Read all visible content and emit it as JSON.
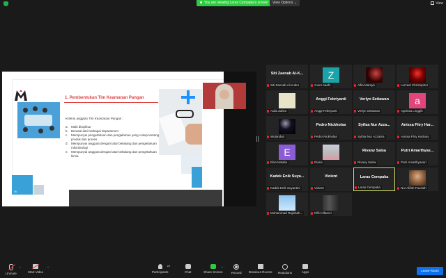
{
  "topbar": {
    "share_banner": "You are viewing Laras Cempaka's screen",
    "view_options": "View Options ⌄",
    "view_label": "View"
  },
  "slide": {
    "title": "1. Pembentukan Tim Keamanan Pangan",
    "criteria_heading": "Kriteria anggota Tim Keamanan Pangan :",
    "criteria": [
      {
        "letter": "a.",
        "text": "Multi disiplinar"
      },
      {
        "letter": "b.",
        "text": "Berasal dari berbagai departemen"
      },
      {
        "letter": "c.",
        "text": "Mempunyai pengetahuan dan pengalaman yang cukup tentang produk dan proses"
      },
      {
        "letter": "d.",
        "text": "Mempunyai anggota dengan latar belakang dan pengetahuan mikrobiologi"
      },
      {
        "letter": "e.",
        "text": "Mempunyai anggota dengan latar belakang dan pengetahuan kimia"
      }
    ],
    "page_number": "06"
  },
  "gallery": [
    {
      "big": "Siti Zaenab Al-K...",
      "label": "Siti Zaenab Al-Kubro"
    },
    {
      "letter": "Z",
      "color": "#1aa3a8",
      "label": "zoom baaf4"
    },
    {
      "avatar": "pink-light",
      "label": "Alfia Marsya"
    },
    {
      "avatar": "red-figure",
      "label": "Lurzael Christopher"
    },
    {
      "avatar": "cream",
      "label": "Aulia Zahra"
    },
    {
      "big": "Anggi Febriyanti",
      "label": "Anggi Febriyanti"
    },
    {
      "big": "Verlyn Setiawan",
      "label": "Verlyn Setiawan"
    },
    {
      "letter": "a",
      "color": "#e0457b",
      "label": "Agnissa Linggih"
    },
    {
      "avatar": "night",
      "label": "Wulandari"
    },
    {
      "big": "Pedro Nickholas",
      "label": "Pedro Nickholas"
    },
    {
      "big": "Syifaa Nur Azza...",
      "label": "Syifaa Nur Azzahra"
    },
    {
      "big": "Anissa Fitry Har...",
      "label": "Anissa Fitry Hartany"
    },
    {
      "letter": "E",
      "color": "#8a5cd6",
      "label": "Elsa Natalia"
    },
    {
      "avatar": "person-grey",
      "label": "Diana"
    },
    {
      "big": "Rivany Salsa",
      "label": "Rivany Salsa"
    },
    {
      "big": "Putri Amarthyas...",
      "label": "Putri Amarthyasari"
    },
    {
      "big": "Kadek Enik Suya...",
      "label": "Kadek Enik Suyantini"
    },
    {
      "big": "Violent",
      "label": "Violent"
    },
    {
      "big": "Laras Cempaka",
      "label": "Laras Cempaka",
      "active": true
    },
    {
      "avatar": "brown",
      "label": "Nur Alifah Fauziah"
    },
    {
      "avatar": "sky",
      "label": "Muhammad Rajishah..."
    },
    {
      "avatar": "doorway",
      "label": "Rifki Alfarezi"
    }
  ],
  "toolbar": {
    "unmute": "Unmute",
    "start_video": "Start Video",
    "participants": "Participants",
    "participants_count": "22",
    "chat": "Chat",
    "share_screen": "Share Screen",
    "record": "Record",
    "breakout": "Breakout Rooms",
    "reactions": "Reactions",
    "apps": "Apps",
    "leave": "Leave Room"
  },
  "colors": {
    "share_green": "#2ecc40",
    "leave_blue": "#0e71eb",
    "active_border": "#d7e36b",
    "title_red": "#e04040"
  }
}
